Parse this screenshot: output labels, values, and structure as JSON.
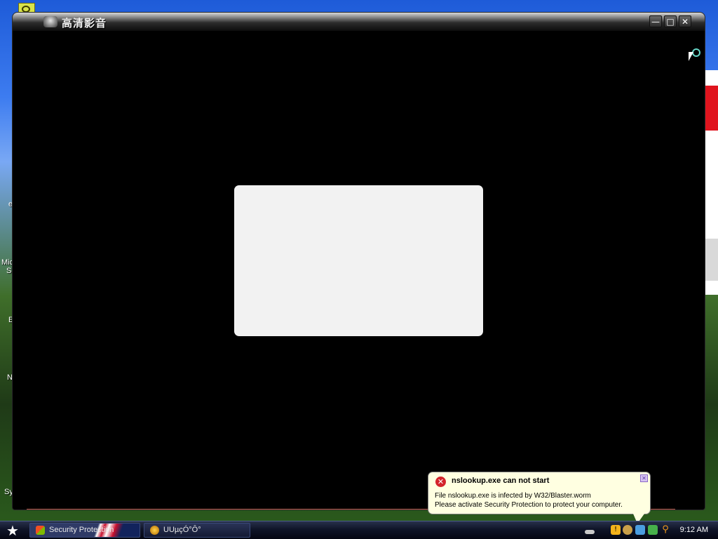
{
  "desktop": {
    "icons": [
      {
        "label": "e"
      },
      {
        "label": "Mic"
      },
      {
        "label": "Sl"
      },
      {
        "label": "E"
      },
      {
        "label": "N"
      },
      {
        "label": "Sy"
      }
    ]
  },
  "player": {
    "title": "高清影音",
    "controls": {
      "minimize": "—",
      "maximize": "□",
      "close": "✕"
    }
  },
  "taskbar": {
    "start_symbol": "★",
    "tasks": [
      {
        "label": "Security Protection"
      },
      {
        "label": "UUµçÓ°Ô°"
      }
    ],
    "clock": "9:12 AM"
  },
  "balloon": {
    "title": "nslookup.exe can not start",
    "line1": "File nslookup.exe is infected by W32/Blaster.worm",
    "line2": "Please activate Security Protection to protect your computer."
  }
}
